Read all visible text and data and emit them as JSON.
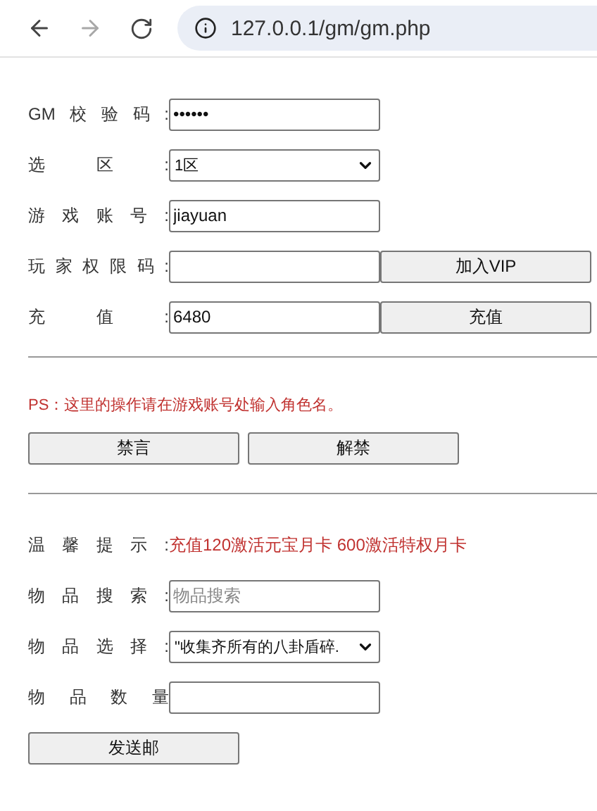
{
  "browser": {
    "url": "127.0.0.1/gm/gm.php",
    "back_disabled": false,
    "forward_disabled": true
  },
  "form_rows": [
    {
      "kind": "input",
      "label": "GM校验码:",
      "value": "••••••"
    },
    {
      "kind": "select",
      "label": "选区:",
      "value": "1区"
    },
    {
      "kind": "input",
      "label": "游戏账号:",
      "value": "jiayuan"
    },
    {
      "kind": "input_button",
      "label": "玩家权限码:",
      "button": "加入VIP"
    },
    {
      "kind": "input_button",
      "label": "充值:",
      "value": "6480",
      "button": "充值"
    }
  ],
  "notice": "PS：这里的操作请在游戏账号处输入角色名。",
  "ban_buttons": [
    "禁言",
    "解禁"
  ],
  "item_rows": [
    {
      "kind": "tip",
      "label": "温馨提示:",
      "text": "充值120激活元宝月卡 600激活特权月卡"
    },
    {
      "kind": "input",
      "label": "物品搜索:",
      "placeholder": "物品搜索"
    },
    {
      "kind": "select",
      "label": "物品选择:",
      "value": "\"收集齐所有的八卦盾碎."
    },
    {
      "kind": "input",
      "label": "物品数量"
    }
  ],
  "send_button": "发送邮"
}
